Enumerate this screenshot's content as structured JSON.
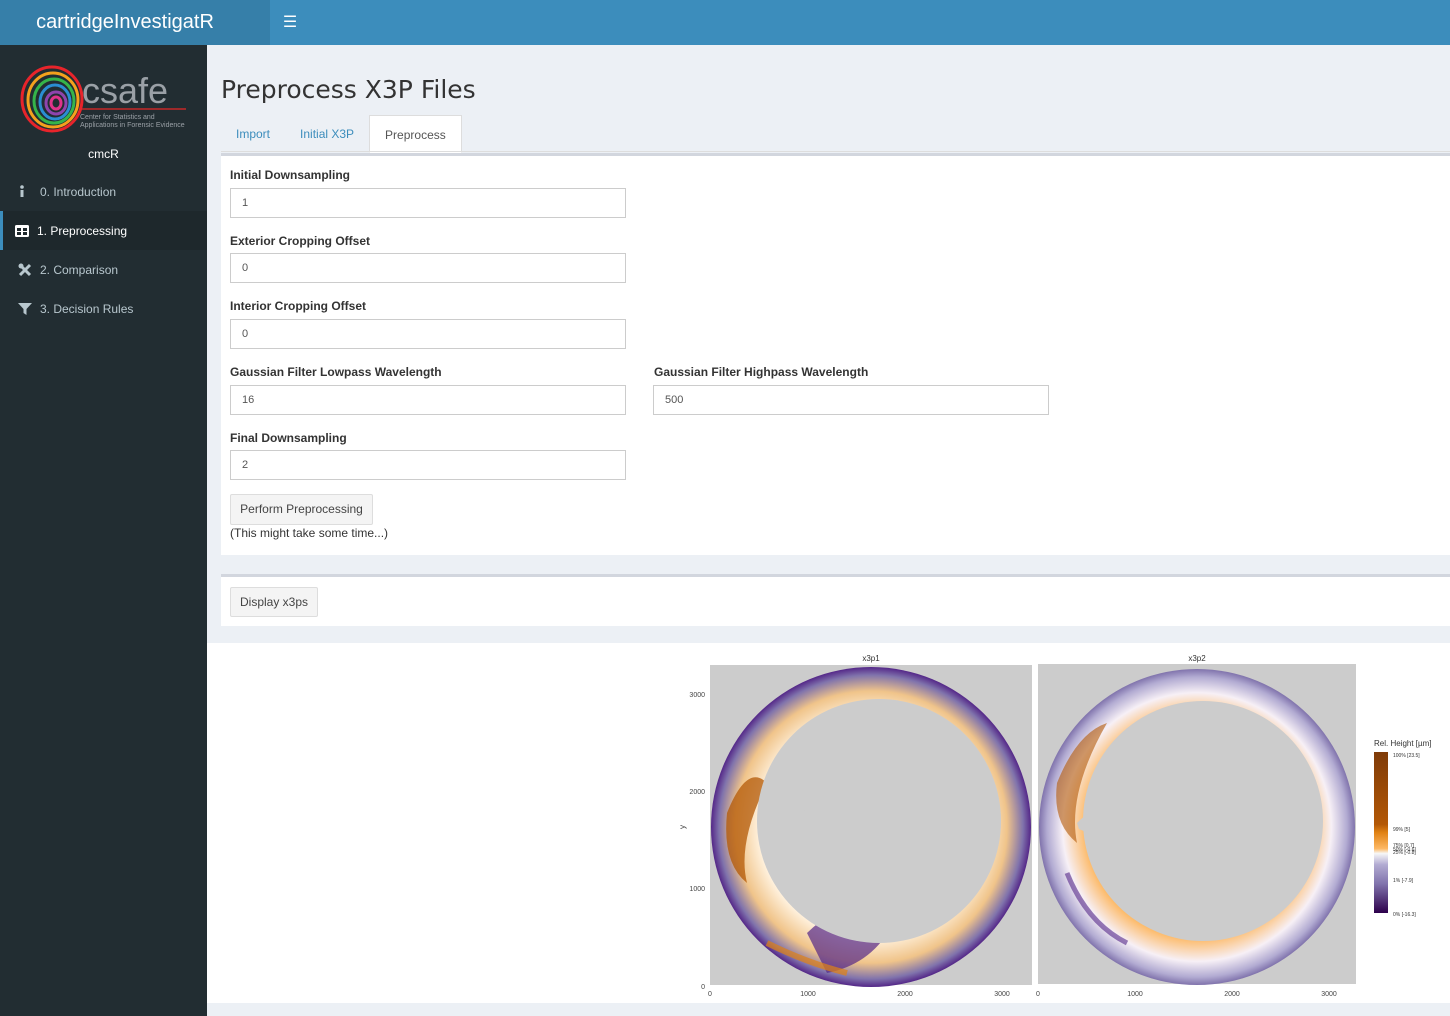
{
  "header": {
    "app_title": "cartridgeInvestigatR",
    "menu_toggle_icon": "hamburger-icon"
  },
  "sidebar": {
    "brand": {
      "logo_text": "csafe",
      "logo_subtitle_line1": "Center for Statistics and",
      "logo_subtitle_line2": "Applications in Forensic Evidence"
    },
    "user_name": "cmcR",
    "items": [
      {
        "label": "0. Introduction",
        "icon": "info-icon",
        "active": false
      },
      {
        "label": "1. Preprocessing",
        "icon": "table-icon",
        "active": true
      },
      {
        "label": "2. Comparison",
        "icon": "tools-icon",
        "active": false
      },
      {
        "label": "3. Decision Rules",
        "icon": "filter-icon",
        "active": false
      }
    ]
  },
  "main": {
    "title": "Preprocess X3P Files",
    "tabs": [
      {
        "label": "Import",
        "active": false
      },
      {
        "label": "Initial X3P",
        "active": false
      },
      {
        "label": "Preprocess",
        "active": true
      }
    ],
    "form": {
      "initial_downsampling": {
        "label": "Initial Downsampling",
        "value": "1"
      },
      "exterior_cropping": {
        "label": "Exterior Cropping Offset",
        "value": "0"
      },
      "interior_cropping": {
        "label": "Interior Cropping Offset",
        "value": "0"
      },
      "lowpass": {
        "label": "Gaussian Filter Lowpass Wavelength",
        "value": "16"
      },
      "highpass": {
        "label": "Gaussian Filter Highpass Wavelength",
        "value": "500"
      },
      "final_downsampling": {
        "label": "Final Downsampling",
        "value": "2"
      },
      "perform_button": "Perform Preprocessing",
      "note": "(This might take some time...)"
    },
    "display_button": "Display x3ps"
  },
  "plot": {
    "panels": [
      "x3p1",
      "x3p2"
    ],
    "y_axis_label": "y",
    "y_ticks": [
      "0",
      "1000",
      "2000",
      "3000"
    ],
    "x_ticks": [
      "0",
      "1000",
      "2000",
      "3000"
    ],
    "legend": {
      "title": "Rel. Height [µm]",
      "labels": [
        "100% [23.5]",
        "99% [5]",
        "75% [0.7]",
        "50% [-0.6]",
        "25% [-0.8]",
        "1% [-7.9]",
        "0% [-16.3]"
      ]
    },
    "colors": {
      "high": "#7f3b08",
      "mid_high": "#e08214",
      "mid": "#f7f7f7",
      "mid_low": "#8073ac",
      "low": "#2d004b",
      "background": "#cccccc"
    }
  }
}
